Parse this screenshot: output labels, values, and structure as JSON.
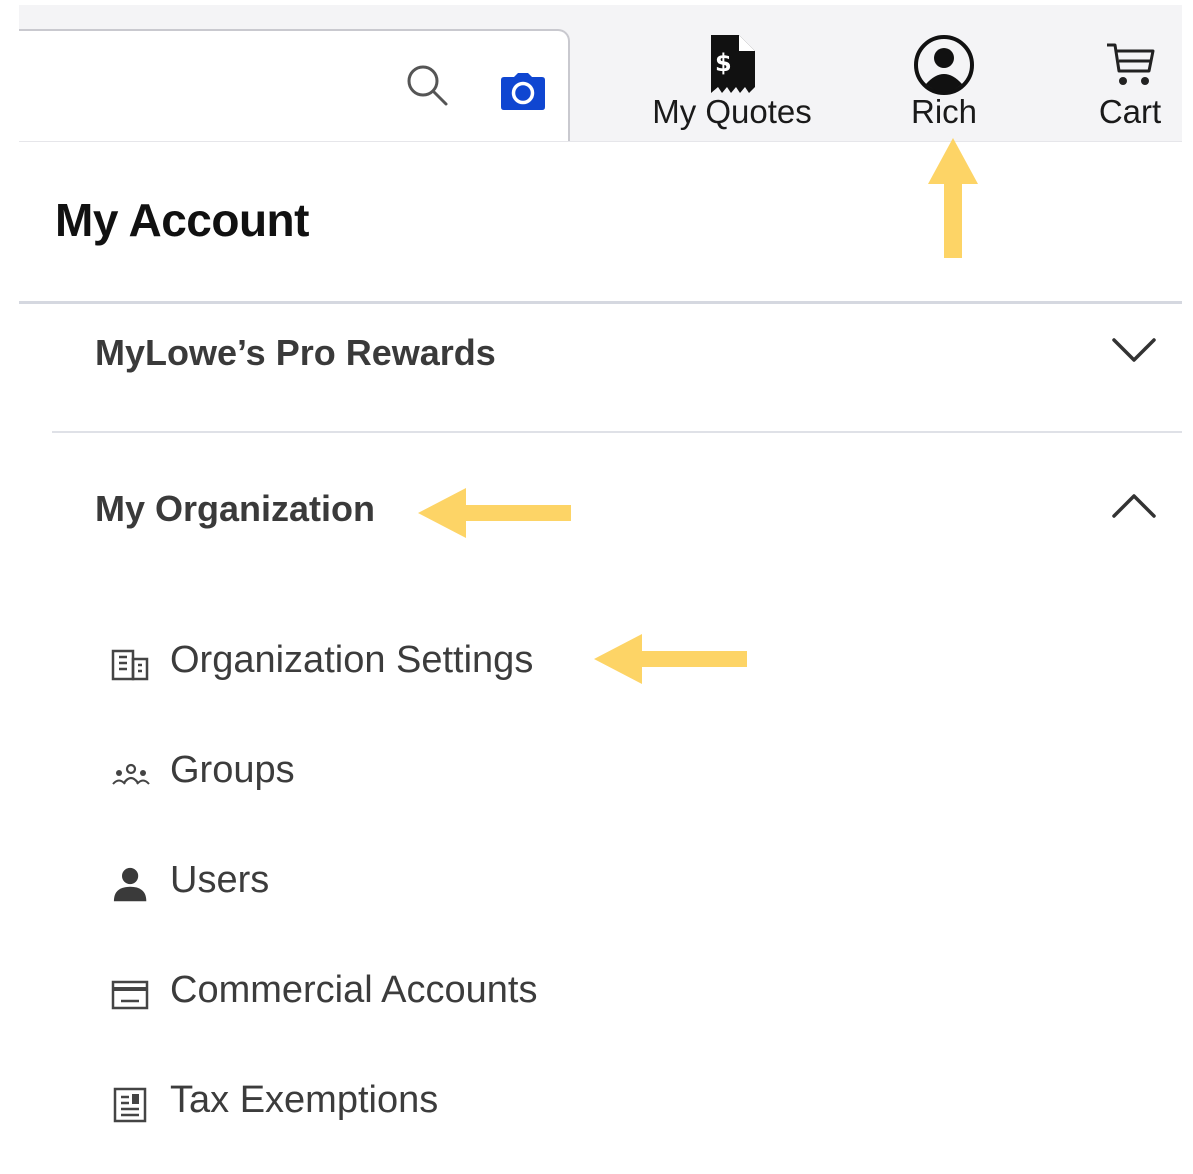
{
  "header": {
    "search": {
      "placeholder": ""
    },
    "nav": {
      "quotes_label": "My Quotes",
      "account_label": "Rich",
      "cart_label": "Cart"
    }
  },
  "page": {
    "title": "My Account"
  },
  "accordion": [
    {
      "label": "MyLowe’s Pro Rewards",
      "state": "collapsed"
    },
    {
      "label": "My Organization",
      "state": "expanded"
    }
  ],
  "organization_items": [
    {
      "label": "Organization Settings",
      "icon": "building-icon"
    },
    {
      "label": "Groups",
      "icon": "group-icon"
    },
    {
      "label": "Users",
      "icon": "user-icon"
    },
    {
      "label": "Commercial Accounts",
      "icon": "credit-card-icon"
    },
    {
      "label": "Tax Exemptions",
      "icon": "document-icon"
    }
  ],
  "colors": {
    "accent_blue": "#0f46d1",
    "annotation_arrow": "#fdd466",
    "topbar_bg": "#f4f4f6"
  }
}
